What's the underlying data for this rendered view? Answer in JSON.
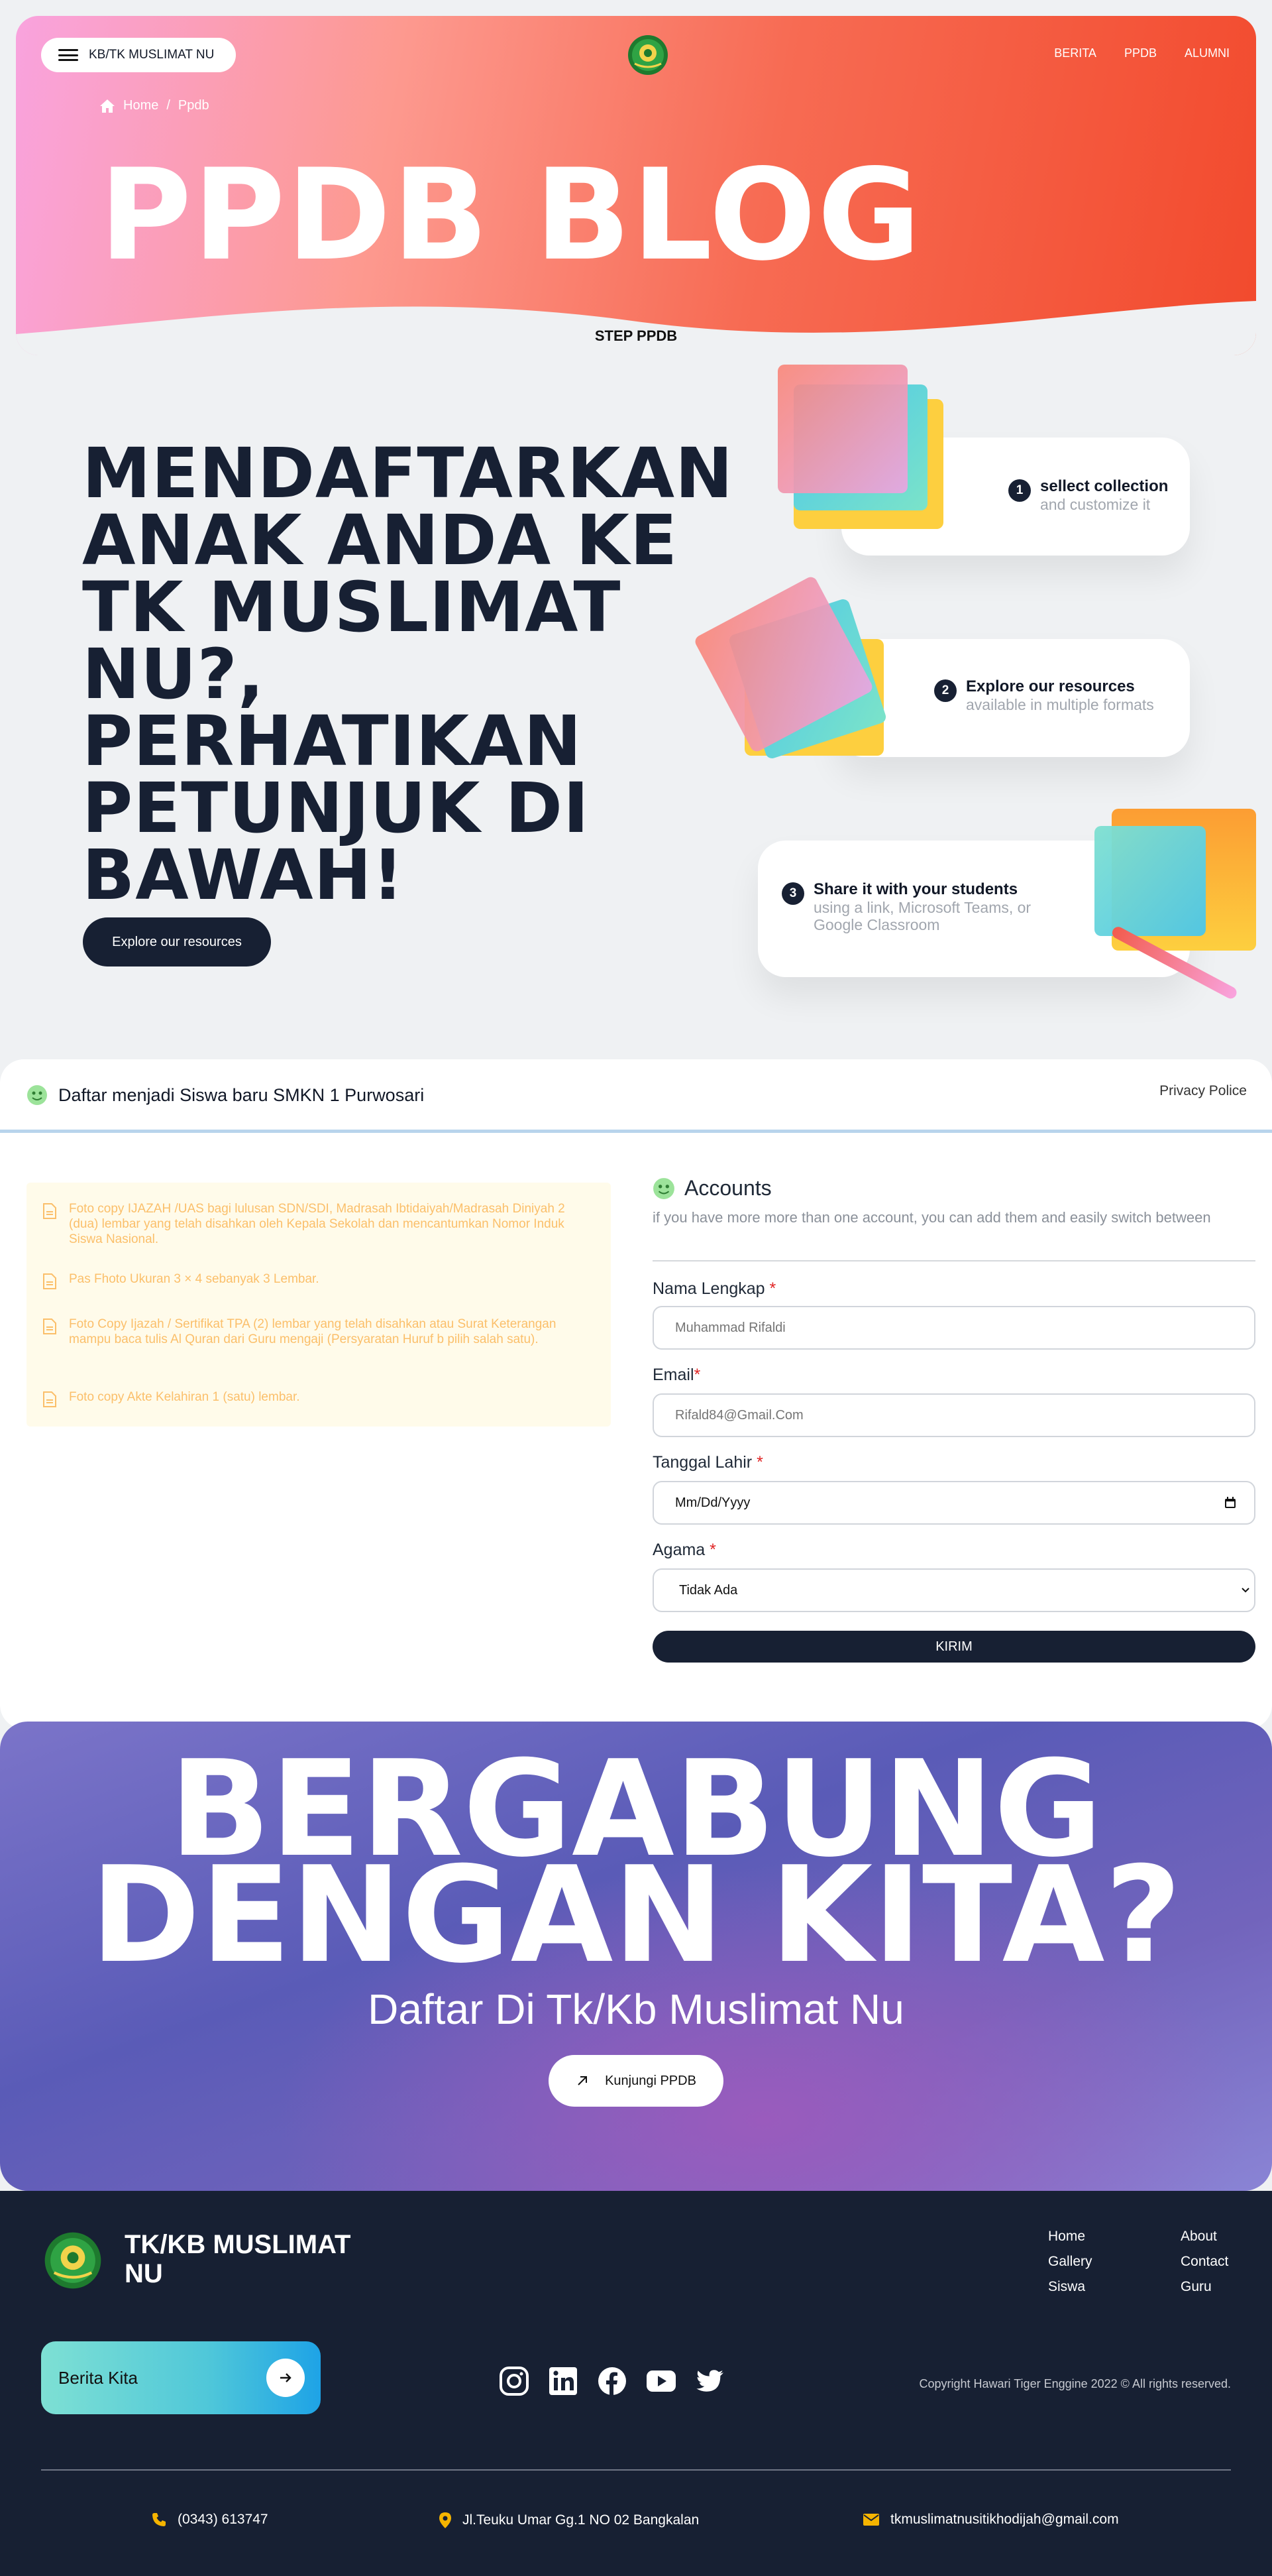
{
  "header": {
    "menu_label": "KB/TK MUSLIMAT NU",
    "nav": [
      "BERITA",
      "PPDB",
      "ALUMNI"
    ],
    "breadcrumb": {
      "home": "Home",
      "separator": "/",
      "current": "Ppdb"
    },
    "title": "PPDB BLOG",
    "step_label": "STEP PPDB"
  },
  "intro": {
    "title": "MENDAFTARKAN ANAK ANDA KE TK MUSLIMAT NU?, PERHATIKAN PETUNJUK DI BAWAH!",
    "button": "Explore our resources"
  },
  "steps": [
    {
      "num": "1",
      "title": "sellect collection",
      "sub": "and customize it"
    },
    {
      "num": "2",
      "title": "Explore our resources",
      "sub": "available in multiple formats"
    },
    {
      "num": "3",
      "title": "Share it with your students",
      "sub": "using a link, Microsoft Teams, or Google Classroom"
    }
  ],
  "form_section": {
    "heading": "Daftar menjadi Siswa baru SMKN 1 Purwosari",
    "privacy": "Privacy Police",
    "requirements": [
      "Foto copy IJAZAH /UAS bagi lulusan SDN/SDI, Madrasah Ibtidaiyah/Madrasah Diniyah 2 (dua) lembar yang telah disahkan oleh Kepala Sekolah dan mencantumkan Nomor Induk Siswa Nasional.",
      "Pas Fhoto Ukuran 3 × 4 sebanyak 3 Lembar.",
      "Foto Copy Ijazah / Sertifikat TPA (2) lembar yang telah disahkan atau Surat Keterangan mampu baca tulis Al Quran dari Guru mengaji (Persyaratan Huruf b pilih salah satu).",
      "Foto copy Akte Kelahiran 1 (satu) lembar."
    ],
    "accounts": {
      "title": "Accounts",
      "subtitle": "if you have more more than one account, you can add them and easily switch between"
    },
    "fields": {
      "name_label": "Nama Lengkap ",
      "name_placeholder": "Muhammad Rifaldi",
      "email_label": "Email",
      "email_placeholder": "Rifald84@Gmail.Com",
      "dob_label": "Tanggal Lahir ",
      "dob_placeholder": "Mm/Dd/Yyyy",
      "religion_label": "Agama ",
      "religion_value": "Tidak Ada",
      "required_mark": "*"
    },
    "submit": "KIRIM"
  },
  "join": {
    "title_line1": "BERGABUNG",
    "title_line2": "DENGAN KITA?",
    "subtitle": "Daftar Di Tk/Kb Muslimat Nu",
    "button": "Kunjungi PPDB"
  },
  "footer": {
    "brand": "TK/KB MUSLIMAT NU",
    "links_col1": [
      "Home",
      "Gallery",
      "Siswa"
    ],
    "links_col2": [
      "About",
      "Contact",
      "Guru"
    ],
    "news_button": "Berita Kita",
    "socials": [
      "instagram-icon",
      "linkedin-icon",
      "facebook-icon",
      "youtube-icon",
      "twitter-icon"
    ],
    "copyright": "Copyright Hawari Tiger Enggine 2022 © All rights reserved.",
    "phone": "(0343) 613747",
    "address": "Jl.Teuku Umar Gg.1 NO 02 Bangkalan",
    "email": "tkmuslimatnusitikhodijah@gmail.com"
  },
  "colors": {
    "dark": "#172033",
    "hero_gradient": [
      "#f9a3de",
      "#f24a2d"
    ],
    "join_gradient": [
      "#7b74c9",
      "#9a5bbd"
    ],
    "requirement_text": "#fbbf6a",
    "contact_icon": "#f5b400"
  }
}
